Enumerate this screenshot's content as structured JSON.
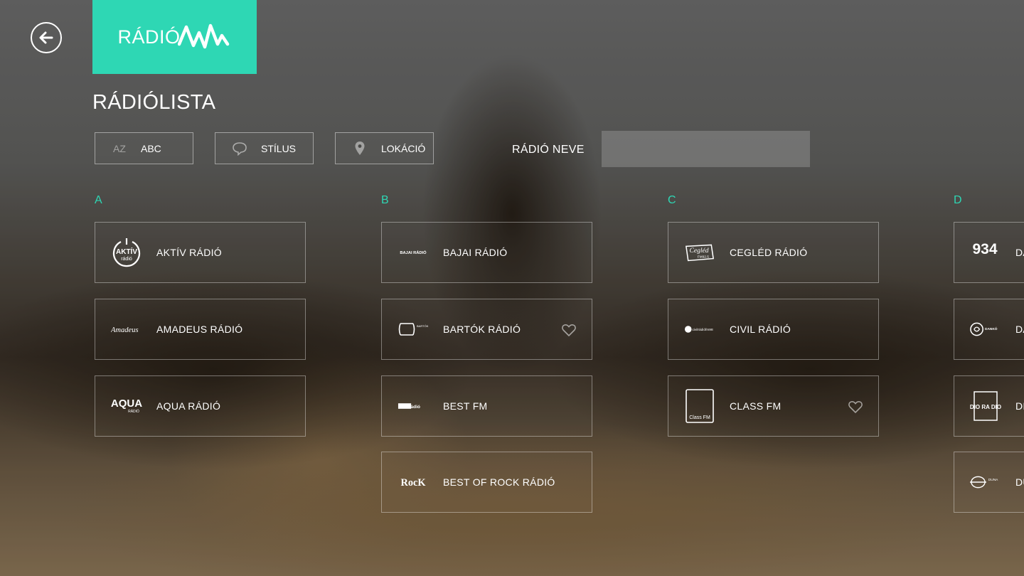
{
  "app": {
    "logo_text": "RÁDIÓ",
    "accent": "#2ed7b4"
  },
  "page_title": "RÁDIÓLISTA",
  "filters": [
    {
      "icon": "az-icon",
      "icon_text": "AZ",
      "label": "ABC"
    },
    {
      "icon": "speech-bubble-icon",
      "label": "STÍLUS"
    },
    {
      "icon": "location-pin-icon",
      "label": "LOKÁCIÓ"
    }
  ],
  "search": {
    "label": "RÁDIÓ NEVE",
    "value": "",
    "placeholder": ""
  },
  "columns": [
    {
      "letter": "A",
      "stations": [
        {
          "name": "AKTÍV RÁDIÓ",
          "logo_text": "AKTÍV",
          "logo_sub": "rádió",
          "favorite_icon": false
        },
        {
          "name": "AMADEUS RÁDIÓ",
          "logo_text": "Amadeus",
          "favorite_icon": false
        },
        {
          "name": "AQUA RÁDIÓ",
          "logo_text": "AQUA",
          "logo_sub": "RÁDIÓ",
          "favorite_icon": false
        }
      ]
    },
    {
      "letter": "B",
      "stations": [
        {
          "name": "BAJAI RÁDIÓ",
          "logo_text": "BAJAI RÁDIÓ",
          "favorite_icon": false
        },
        {
          "name": "BARTÓK RÁDIÓ",
          "logo_text": "BARTÓK",
          "favorite_icon": true
        },
        {
          "name": "BEST FM",
          "logo_text": "bestrádió",
          "favorite_icon": false
        },
        {
          "name": "BEST OF ROCK RÁDIÓ",
          "logo_text": "RocK",
          "favorite_icon": false
        }
      ]
    },
    {
      "letter": "C",
      "stations": [
        {
          "name": "CEGLÉD RÁDIÓ",
          "logo_text": "Cegléd",
          "logo_sub": "FM92.5",
          "favorite_icon": false
        },
        {
          "name": "CIVIL RÁDIÓ",
          "logo_text": "civilrádiófm98",
          "favorite_icon": false
        },
        {
          "name": "CLASS FM",
          "logo_text": "Class FM",
          "favorite_icon": true
        }
      ]
    },
    {
      "letter": "D",
      "stations": [
        {
          "name": "DA",
          "logo_text": "934",
          "favorite_icon": false
        },
        {
          "name": "DA",
          "logo_text": "DANKÓ",
          "favorite_icon": false
        },
        {
          "name": "DI",
          "logo_text": "DIO RA DIO",
          "favorite_icon": false
        },
        {
          "name": "DU",
          "logo_text": "DUNA",
          "favorite_icon": false
        }
      ]
    }
  ]
}
